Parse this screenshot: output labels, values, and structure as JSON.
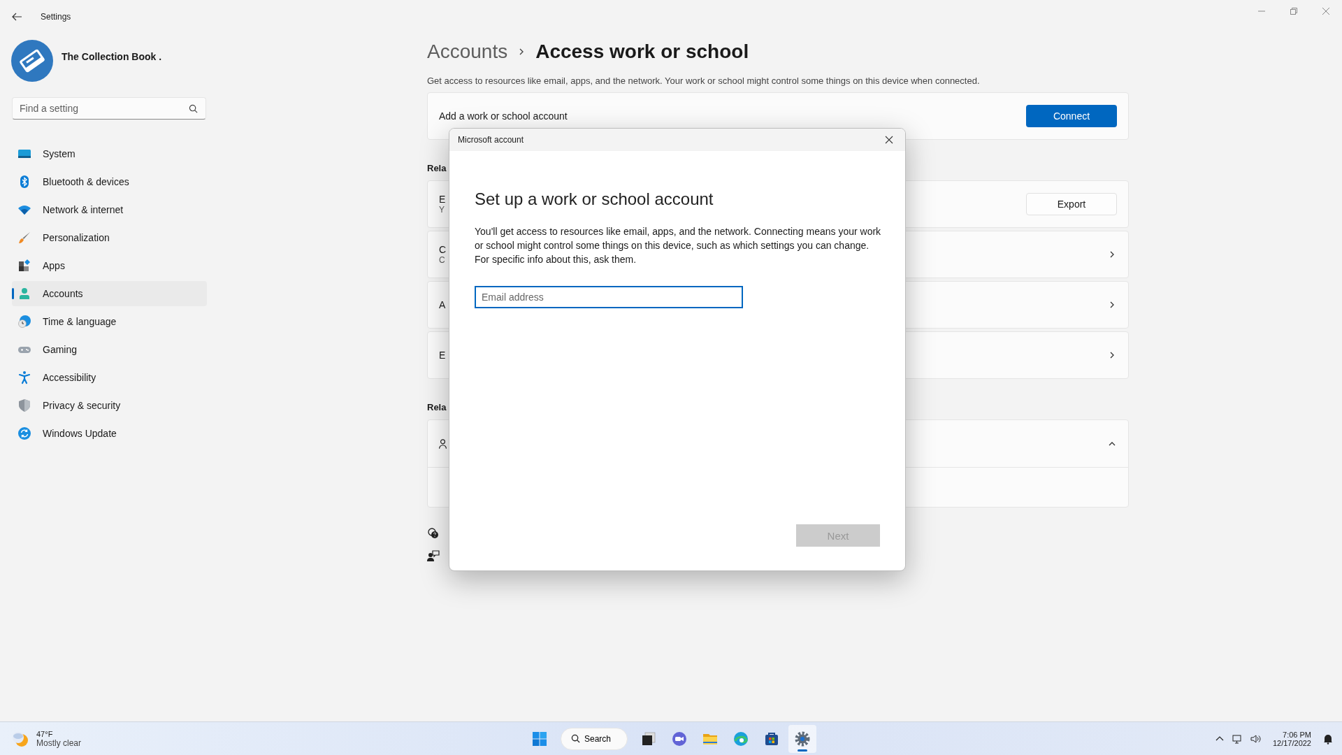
{
  "window": {
    "title": "Settings"
  },
  "profile": {
    "name": "The Collection Book ."
  },
  "search": {
    "placeholder": "Find a setting"
  },
  "nav": [
    {
      "label": "System",
      "kind": "system",
      "selected": false
    },
    {
      "label": "Bluetooth & devices",
      "kind": "bluetooth",
      "selected": false
    },
    {
      "label": "Network & internet",
      "kind": "network",
      "selected": false
    },
    {
      "label": "Personalization",
      "kind": "personalization",
      "selected": false
    },
    {
      "label": "Apps",
      "kind": "apps",
      "selected": false
    },
    {
      "label": "Accounts",
      "kind": "accounts",
      "selected": true
    },
    {
      "label": "Time & language",
      "kind": "time",
      "selected": false
    },
    {
      "label": "Gaming",
      "kind": "gaming",
      "selected": false
    },
    {
      "label": "Accessibility",
      "kind": "accessibility",
      "selected": false
    },
    {
      "label": "Privacy & security",
      "kind": "privacy",
      "selected": false
    },
    {
      "label": "Windows Update",
      "kind": "update",
      "selected": false
    }
  ],
  "breadcrumb": {
    "parent": "Accounts",
    "current": "Access work or school"
  },
  "description": "Get access to resources like email, apps, and the network. Your work or school might control some things on this device when connected.",
  "add_account": {
    "label": "Add a work or school account",
    "button": "Connect"
  },
  "sections": [
    {
      "heading": "Rela",
      "rows": [
        {
          "kind": "button",
          "title": "E",
          "subtitle": "Y",
          "button": "Export"
        },
        {
          "kind": "link",
          "title": "C",
          "subtitle": "C"
        },
        {
          "kind": "link",
          "title": "A"
        },
        {
          "kind": "link",
          "title": "E"
        }
      ]
    },
    {
      "heading": "Rela",
      "rows": [
        {
          "kind": "expander",
          "expanded": true
        }
      ]
    }
  ],
  "dialog": {
    "title": "Microsoft account",
    "heading": "Set up a work or school account",
    "body": "You'll get access to resources like email, apps, and the network. Connecting means your work or school might control some things on this device, such as which settings you can change. For specific info about this, ask them.",
    "email": {
      "placeholder": "Email address"
    },
    "next": {
      "label": "Next",
      "disabled": true
    }
  },
  "taskbar": {
    "weather": {
      "temp": "47°F",
      "condition": "Mostly clear"
    },
    "search": "Search",
    "apps": [
      {
        "kind": "taskview",
        "active": false
      },
      {
        "kind": "chat",
        "active": false
      },
      {
        "kind": "explorer",
        "active": false
      },
      {
        "kind": "edge",
        "active": false
      },
      {
        "kind": "store",
        "active": false
      },
      {
        "kind": "settings",
        "active": true
      }
    ],
    "clock": {
      "time": "7:06 PM",
      "date": "12/17/2022"
    }
  }
}
